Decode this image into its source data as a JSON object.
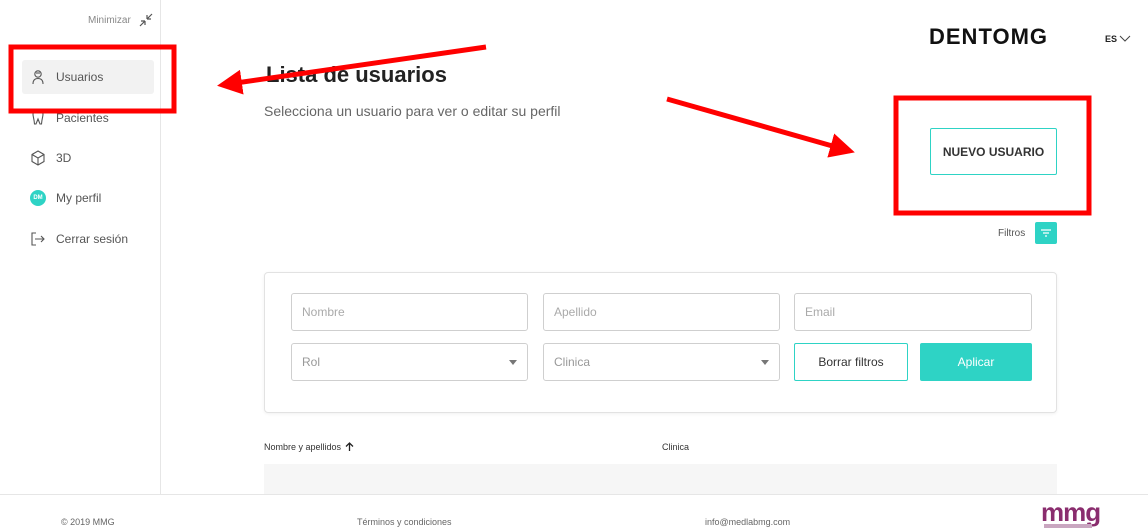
{
  "sidebar": {
    "minimize_label": "Minimizar",
    "items": [
      {
        "label": "Usuarios",
        "icon": "user-icon"
      },
      {
        "label": "Pacientes",
        "icon": "tooth-icon"
      },
      {
        "label": "3D",
        "icon": "cube-icon"
      },
      {
        "label": "My perfil",
        "icon": "avatar-icon",
        "avatar_initials": "DM"
      },
      {
        "label": "Cerrar sesión",
        "icon": "logout-icon"
      }
    ]
  },
  "header": {
    "logo": "DENTOMG",
    "language": "ES"
  },
  "main": {
    "title": "Lista de usuarios",
    "subtitle": "Selecciona un usuario para ver o editar su perfil",
    "new_user_label": "NUEVO USUARIO",
    "filters_label": "Filtros"
  },
  "filters": {
    "nombre_placeholder": "Nombre",
    "apellido_placeholder": "Apellido",
    "email_placeholder": "Email",
    "rol_value": "Rol",
    "clinica_value": "Clinica",
    "clear_label": "Borrar filtros",
    "apply_label": "Aplicar"
  },
  "table": {
    "columns": [
      "Nombre y apellidos",
      "Clinica"
    ]
  },
  "footer": {
    "copyright": "© 2019 MMG",
    "terms": "Términos y condiciones",
    "email": "info@medlabmg.com",
    "brand": "mmg"
  },
  "colors": {
    "accent": "#2ed3c5",
    "annotation": "#ff0000"
  }
}
